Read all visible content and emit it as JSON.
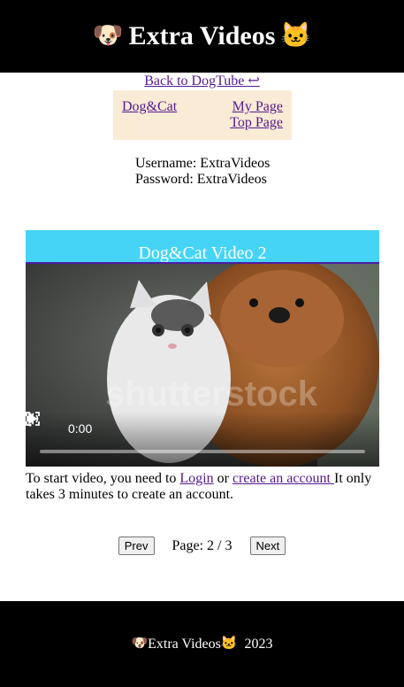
{
  "header": {
    "title": "Extra Videos",
    "dog_icon": "dog-face-icon",
    "cat_icon": "cat-face-icon"
  },
  "back_link": "Back to DogTube ↩",
  "nav": {
    "left_link": "Dog&Cat",
    "my_page": "My Page",
    "top_page": "Top Page"
  },
  "credentials": {
    "username": "Username: ExtraVideos",
    "password": "Password: ExtraVideos"
  },
  "video": {
    "title": "Dog&Cat Video 2",
    "watermark": "shutterstock",
    "time": "0:00",
    "progress": 0
  },
  "notice": {
    "prefix": "To start video, you need to ",
    "login": "Login",
    "or": " or ",
    "create": "create an account ",
    "suffix": "It only takes 3 minutes to create an account."
  },
  "pager": {
    "prev": "Prev",
    "info": "Page: 2 / 3",
    "next": "Next"
  },
  "footer": {
    "brand": "Extra Videos",
    "year": "2023"
  },
  "colors": {
    "title_bar": "#45d4f5",
    "nav_bg": "#faebd7",
    "link": "#551a8b"
  }
}
